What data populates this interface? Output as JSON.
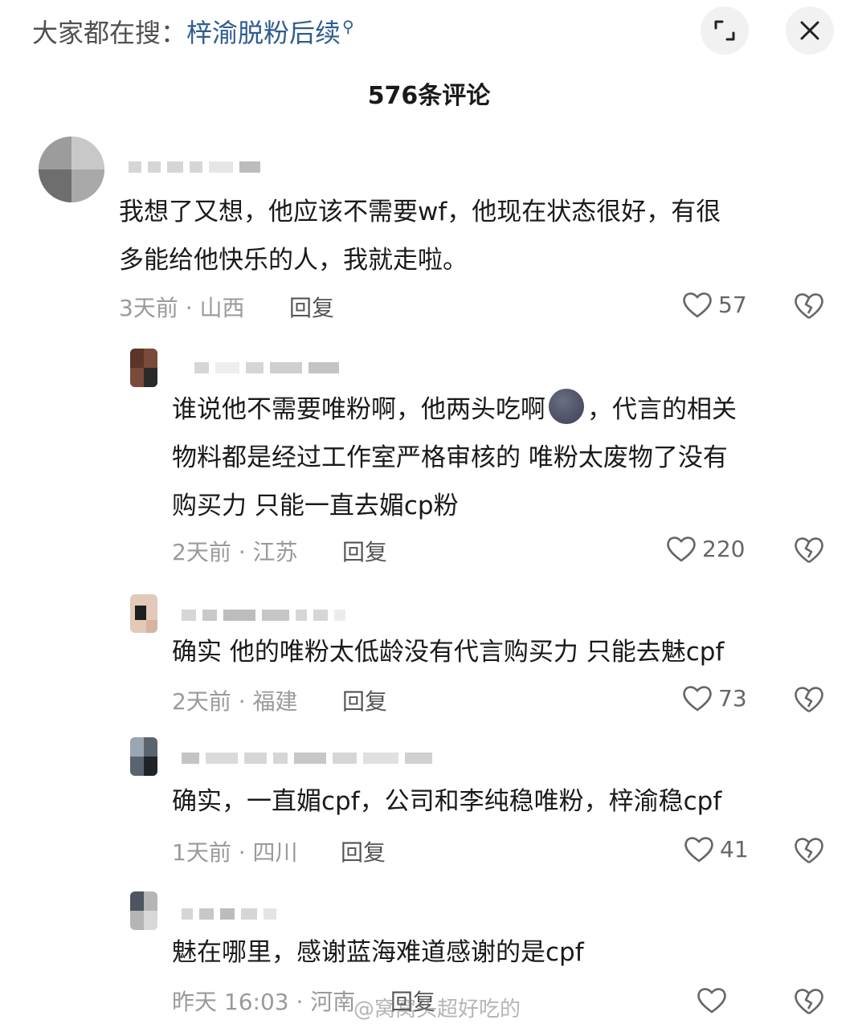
{
  "header": {
    "search_prefix": "大家都在搜：",
    "search_term": "梓渝脱粉后续",
    "comments_count": "576条评论"
  },
  "comments": [
    {
      "text": "我想了又想，他应该不需要wf，他现在状态很好，有很\n多能给他快乐的人，我就走啦。",
      "meta": "3天前 · 山西",
      "reply": "回复",
      "likes": "57"
    },
    {
      "text_before_emoji": "谁说他不需要唯粉啊，他两头吃啊",
      "text_after_emoji": "，代言的相关\n物料都是经过工作室严格审核的 唯粉太废物了没有\n购买力 只能一直去媚cp粉",
      "meta": "2天前 · 江苏",
      "reply": "回复",
      "likes": "220"
    },
    {
      "text": "确实 他的唯粉太低龄没有代言购买力 只能去魅cpf",
      "meta": "2天前 · 福建",
      "reply": "回复",
      "likes": "73"
    },
    {
      "text": "确实，一直媚cpf，公司和李纯稳唯粉，梓渝稳cpf",
      "meta": "1天前 · 四川",
      "reply": "回复",
      "likes": "41"
    },
    {
      "text": "魅在哪里，感谢蓝海难道感谢的是cpf",
      "meta": "昨天 16:03 · 河南",
      "reply": "回复"
    }
  ],
  "watermark": "@窝窝头超好吃的",
  "colors": {
    "link": "#2f5d8f",
    "meta": "#9a9a9a",
    "text": "#1a1a1a"
  }
}
